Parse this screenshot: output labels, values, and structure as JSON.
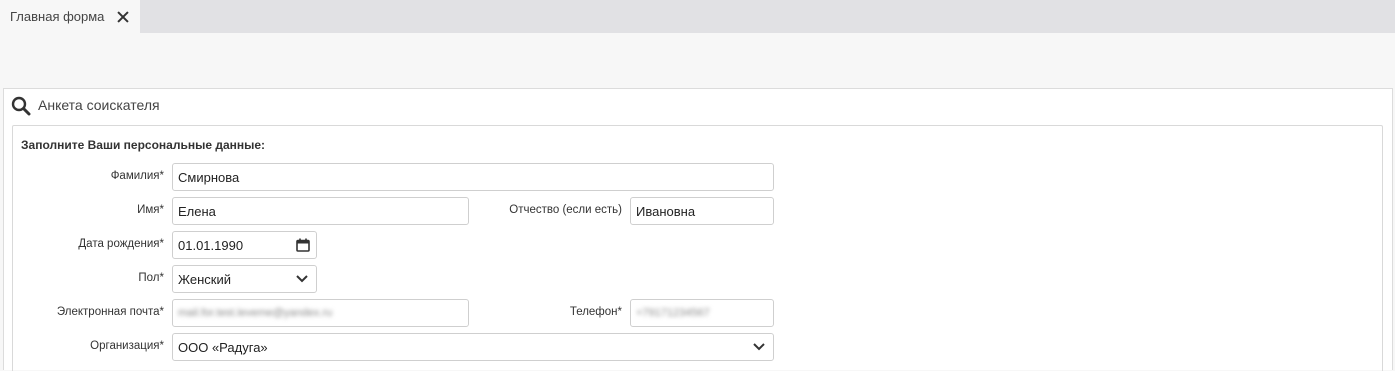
{
  "tabs": [
    {
      "label": "Главная форма"
    }
  ],
  "panel": {
    "title": "Анкета соискателя",
    "section_title": "Заполните Ваши персональные данные:"
  },
  "form": {
    "last_name": {
      "label": "Фамилия*",
      "value": "Смирнова"
    },
    "first_name": {
      "label": "Имя*",
      "value": "Елена"
    },
    "middle_name": {
      "label": "Отчество (если есть)",
      "value": "Ивановна"
    },
    "birth_date": {
      "label": "Дата рождения*",
      "value": "01.01.1990"
    },
    "gender": {
      "label": "Пол*",
      "value": "Женский"
    },
    "email": {
      "label": "Электронная почта*",
      "value": "mail.for.test.leveme@yandex.ru"
    },
    "phone": {
      "label": "Телефон*",
      "value": "+79171234567"
    },
    "organization": {
      "label": "Организация*",
      "value": "ООО «Радуга»"
    }
  },
  "icons": {
    "tab_close": "close-icon",
    "search": "search-icon",
    "calendar": "calendar-icon",
    "chevron": "chevron-down-icon"
  }
}
